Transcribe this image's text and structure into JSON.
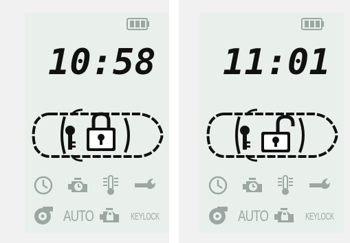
{
  "colors": {
    "lcd_background": "#e9f0ec",
    "segment_on": "#111111",
    "segment_dim": "#9aa7a2",
    "page_background": "#f1f1f1"
  },
  "panels": [
    {
      "time": "10:58",
      "lock_state": "locked",
      "icons": {
        "row1": [
          "clock-icon",
          "engine-timer-icon",
          "temperature-icon",
          "wrench-icon"
        ],
        "row2": [
          "turbo-icon",
          "auto-label",
          "engine-lock-icon",
          "keylock-label"
        ]
      },
      "auto_label": "AUTO",
      "keylock_label": "KEYLOCK"
    },
    {
      "time": "11:01",
      "lock_state": "unlocked",
      "icons": {
        "row1": [
          "clock-icon",
          "engine-timer-icon",
          "temperature-icon",
          "wrench-icon"
        ],
        "row2": [
          "turbo-icon",
          "auto-label",
          "engine-lock-icon",
          "keylock-label"
        ]
      },
      "auto_label": "AUTO",
      "keylock_label": "KEYLOCK"
    }
  ]
}
